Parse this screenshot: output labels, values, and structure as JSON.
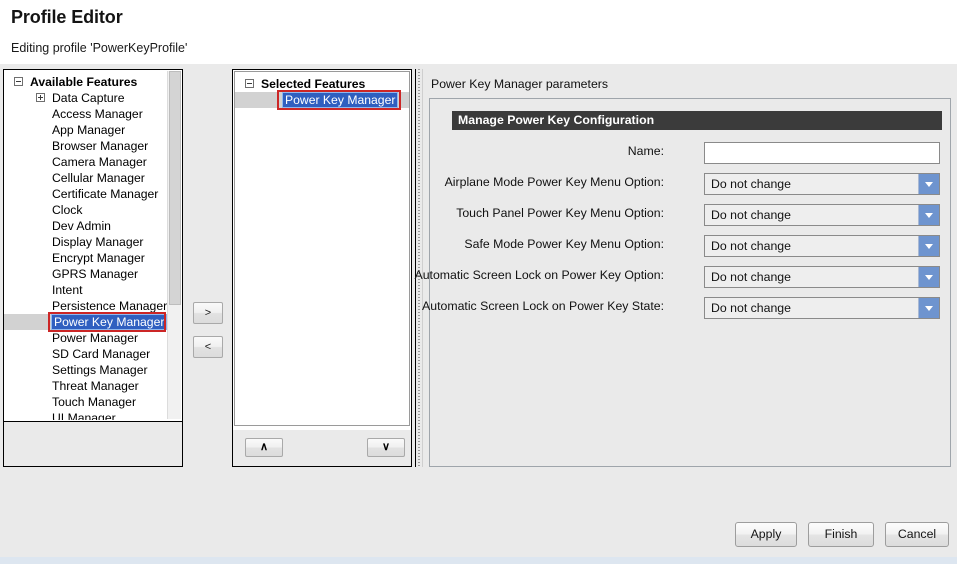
{
  "header": {
    "title": "Profile Editor",
    "subtitle": "Editing profile 'PowerKeyProfile'"
  },
  "available_features": {
    "root_label": "Available Features",
    "items": [
      {
        "label": "Data Capture",
        "expandable": true,
        "expanded": false,
        "selected": false
      },
      {
        "label": "Access Manager",
        "expandable": false,
        "expanded": false,
        "selected": false
      },
      {
        "label": "App Manager",
        "expandable": false,
        "expanded": false,
        "selected": false
      },
      {
        "label": "Browser Manager",
        "expandable": false,
        "expanded": false,
        "selected": false
      },
      {
        "label": "Camera Manager",
        "expandable": false,
        "expanded": false,
        "selected": false
      },
      {
        "label": "Cellular Manager",
        "expandable": false,
        "expanded": false,
        "selected": false
      },
      {
        "label": "Certificate Manager",
        "expandable": false,
        "expanded": false,
        "selected": false
      },
      {
        "label": "Clock",
        "expandable": false,
        "expanded": false,
        "selected": false
      },
      {
        "label": "Dev Admin",
        "expandable": false,
        "expanded": false,
        "selected": false
      },
      {
        "label": "Display Manager",
        "expandable": false,
        "expanded": false,
        "selected": false
      },
      {
        "label": "Encrypt Manager",
        "expandable": false,
        "expanded": false,
        "selected": false
      },
      {
        "label": "GPRS Manager",
        "expandable": false,
        "expanded": false,
        "selected": false
      },
      {
        "label": "Intent",
        "expandable": false,
        "expanded": false,
        "selected": false
      },
      {
        "label": "Persistence Manager",
        "expandable": false,
        "expanded": false,
        "selected": false
      },
      {
        "label": "Power Key Manager",
        "expandable": false,
        "expanded": false,
        "selected": true
      },
      {
        "label": "Power Manager",
        "expandable": false,
        "expanded": false,
        "selected": false
      },
      {
        "label": "SD Card Manager",
        "expandable": false,
        "expanded": false,
        "selected": false
      },
      {
        "label": "Settings Manager",
        "expandable": false,
        "expanded": false,
        "selected": false
      },
      {
        "label": "Threat Manager",
        "expandable": false,
        "expanded": false,
        "selected": false
      },
      {
        "label": "Touch Manager",
        "expandable": false,
        "expanded": false,
        "selected": false
      },
      {
        "label": "UI Manager",
        "expandable": false,
        "expanded": false,
        "selected": false
      }
    ]
  },
  "transfer": {
    "add_label": ">",
    "remove_label": "<"
  },
  "selected_features": {
    "root_label": "Selected Features",
    "items": [
      {
        "label": "Power Key Manager",
        "selected": true
      }
    ],
    "move_up_label": "∧",
    "move_down_label": "∨"
  },
  "parameters": {
    "title": "Power Key Manager parameters",
    "group_title": "Manage Power Key Configuration",
    "fields": [
      {
        "label": "Name:",
        "type": "text",
        "value": "",
        "placeholder": ""
      },
      {
        "label": "Airplane Mode Power Key Menu Option:",
        "type": "combo",
        "value": "Do not change"
      },
      {
        "label": "Touch Panel Power Key Menu Option:",
        "type": "combo",
        "value": "Do not change"
      },
      {
        "label": "Safe Mode Power Key Menu Option:",
        "type": "combo",
        "value": "Do not change"
      },
      {
        "label": "Automatic Screen Lock on Power Key Option:",
        "type": "combo",
        "value": "Do not change"
      },
      {
        "label": "Automatic Screen Lock on Power Key State:",
        "type": "combo",
        "value": "Do not change"
      }
    ]
  },
  "footer": {
    "apply_label": "Apply",
    "finish_label": "Finish",
    "cancel_label": "Cancel"
  },
  "colors": {
    "selection_blue": "#2f5fc0",
    "highlight_red": "#cc2626",
    "group_header_bg": "#3b3b3b",
    "combo_arrow_blue": "#6e94cf",
    "panel_bg": "#eaeaea"
  }
}
